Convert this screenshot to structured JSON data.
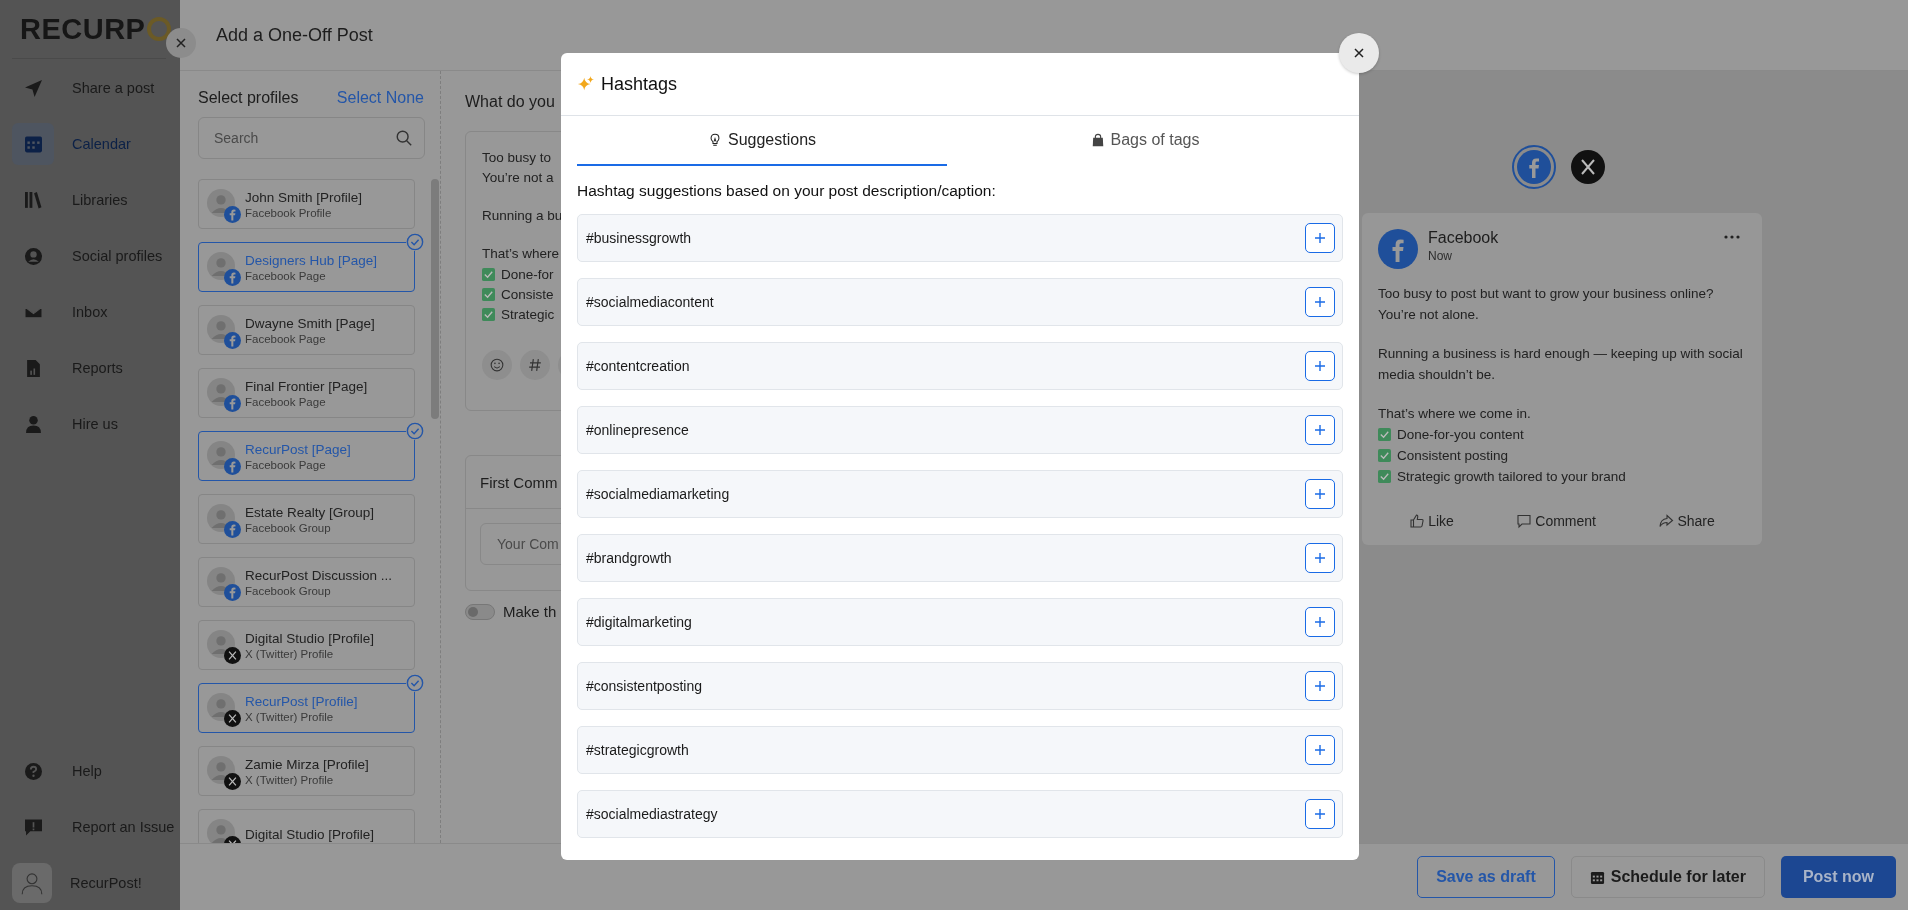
{
  "sidebar": {
    "logo": "RECURP",
    "items": [
      {
        "label": "Share a post",
        "selected": false
      },
      {
        "label": "Calendar",
        "selected": true
      },
      {
        "label": "Libraries",
        "selected": false
      },
      {
        "label": "Social profiles",
        "selected": false
      },
      {
        "label": "Inbox",
        "selected": false
      },
      {
        "label": "Reports",
        "selected": false
      },
      {
        "label": "Hire us",
        "selected": false
      }
    ],
    "bottom_items": [
      {
        "label": "Help"
      },
      {
        "label": "Report an Issue"
      }
    ],
    "user": {
      "name": "RecurPost!"
    }
  },
  "drawer": {
    "title": "Add a One-Off Post",
    "profiles": {
      "heading": "Select profiles",
      "select_none": "Select None",
      "search": {
        "placeholder": "Search"
      },
      "items": [
        {
          "name": "John Smith [Profile]",
          "type": "Facebook Profile",
          "kind": "facebook",
          "selected": false
        },
        {
          "name": "Designers Hub [Page]",
          "type": "Facebook Page",
          "kind": "facebook",
          "selected": true
        },
        {
          "name": "Dwayne Smith [Page]",
          "type": "Facebook Page",
          "kind": "facebook",
          "selected": false
        },
        {
          "name": "Final Frontier [Page]",
          "type": "Facebook Page",
          "kind": "facebook",
          "selected": false
        },
        {
          "name": "RecurPost [Page]",
          "type": "Facebook Page",
          "kind": "facebook",
          "selected": true
        },
        {
          "name": "Estate Realty [Group]",
          "type": "Facebook Group",
          "kind": "facebook",
          "selected": false
        },
        {
          "name": "RecurPost Discussion ...",
          "type": "Facebook Group",
          "kind": "facebook",
          "selected": false
        },
        {
          "name": "Digital Studio [Profile]",
          "type": "X (Twitter) Profile",
          "kind": "x",
          "selected": false
        },
        {
          "name": "RecurPost [Profile]",
          "type": "X (Twitter) Profile",
          "kind": "x",
          "selected": true
        },
        {
          "name": "Zamie Mirza [Profile]",
          "type": "X (Twitter) Profile",
          "kind": "x",
          "selected": false
        },
        {
          "name": "Digital Studio [Profile]",
          "kind": "x",
          "selected": false
        }
      ]
    },
    "composer": {
      "heading": "What do you",
      "lines": [
        {
          "kind": "text",
          "text": "Too busy to"
        },
        {
          "kind": "text",
          "text": "You’re not a"
        },
        {
          "kind": "gap"
        },
        {
          "kind": "text",
          "text": "Running a bu"
        },
        {
          "kind": "gap"
        },
        {
          "kind": "text",
          "text": "That’s where"
        },
        {
          "kind": "check",
          "text": "Done-for"
        },
        {
          "kind": "check",
          "text": "Consiste"
        },
        {
          "kind": "check",
          "text": "Strategic"
        }
      ],
      "first_comment": {
        "heading": "First Comm",
        "placeholder": "Your Com"
      },
      "toggle": {
        "label": "Make th",
        "on": false
      }
    },
    "preview": {
      "networks": [
        {
          "kind": "facebook",
          "selected": true
        },
        {
          "kind": "x",
          "selected": false
        }
      ],
      "post": {
        "account": "Facebook",
        "time": "Now",
        "lines": [
          {
            "kind": "text",
            "text": "Too busy to post but want to grow your business online?"
          },
          {
            "kind": "text",
            "text": "You’re not alone."
          },
          {
            "kind": "gap"
          },
          {
            "kind": "text",
            "text": "Running a business is hard enough — keeping up with social media shouldn’t be."
          },
          {
            "kind": "gap"
          },
          {
            "kind": "text",
            "text": "That’s where we come in."
          },
          {
            "kind": "check",
            "text": "Done-for-you content"
          },
          {
            "kind": "check",
            "text": "Consistent posting"
          },
          {
            "kind": "check",
            "text": "Strategic growth tailored to your brand"
          }
        ],
        "actions": [
          "Like",
          "Comment",
          "Share"
        ]
      }
    },
    "footer": {
      "buttons": [
        {
          "label": "Save as draft",
          "kind": "outline"
        },
        {
          "label": "Schedule for later",
          "kind": "schedule"
        },
        {
          "label": "Post now",
          "kind": "primary"
        }
      ]
    }
  },
  "modal": {
    "title": "Hashtags",
    "tabs": [
      {
        "label": "Suggestions",
        "selected": true
      },
      {
        "label": "Bags of tags",
        "selected": false
      }
    ],
    "description": "Hashtag suggestions based on your post description/caption:",
    "hashtags": [
      "#businessgrowth",
      "#socialmediacontent",
      "#contentcreation",
      "#onlinepresence",
      "#socialmediamarketing",
      "#brandgrowth",
      "#digitalmarketing",
      "#consistentposting",
      "#strategicgrowth",
      "#socialmediastrategy"
    ]
  }
}
